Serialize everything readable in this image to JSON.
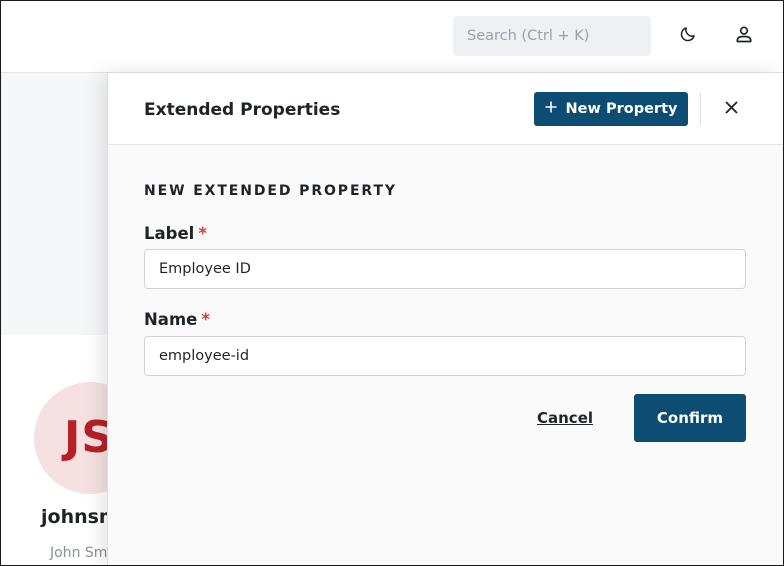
{
  "header": {
    "search": {
      "placeholder": "Search (Ctrl + K)",
      "value": ""
    },
    "icons": {
      "theme": "moon-icon",
      "user": "user-icon"
    }
  },
  "background": {
    "avatar_initials": "JS",
    "username": "johnsmith",
    "full_name": "John Smith"
  },
  "panel": {
    "title": "Extended Properties",
    "new_property_label": "New Property",
    "section_title": "NEW EXTENDED PROPERTY",
    "fields": [
      {
        "label": "Label",
        "required_marker": "*",
        "value": "Employee ID"
      },
      {
        "label": "Name",
        "required_marker": "*",
        "value": "employee-id"
      }
    ],
    "cancel_label": "Cancel",
    "confirm_label": "Confirm"
  },
  "colors": {
    "primary": "#0d4c73",
    "required": "#d63a3a",
    "avatar_bg": "#f5e1e1",
    "avatar_text": "#b81f27"
  }
}
